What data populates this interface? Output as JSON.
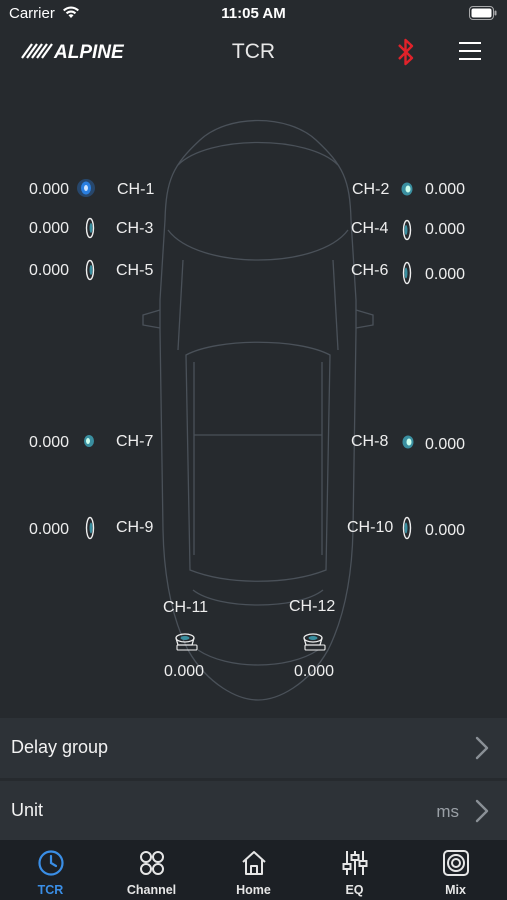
{
  "status": {
    "carrier": "Carrier",
    "time": "11:05 AM"
  },
  "header": {
    "title": "TCR",
    "logo_text": "ALPINE",
    "bt_color": "#e0222a"
  },
  "channels": [
    {
      "label": "CH-1",
      "value": "0.000"
    },
    {
      "label": "CH-2",
      "value": "0.000"
    },
    {
      "label": "CH-3",
      "value": "0.000"
    },
    {
      "label": "CH-4",
      "value": "0.000"
    },
    {
      "label": "CH-5",
      "value": "0.000"
    },
    {
      "label": "CH-6",
      "value": "0.000"
    },
    {
      "label": "CH-7",
      "value": "0.000"
    },
    {
      "label": "CH-8",
      "value": "0.000"
    },
    {
      "label": "CH-9",
      "value": "0.000"
    },
    {
      "label": "CH-10",
      "value": "0.000"
    },
    {
      "label": "CH-11",
      "value": "0.000"
    },
    {
      "label": "CH-12",
      "value": "0.000"
    }
  ],
  "settings": {
    "delay_group": {
      "label": "Delay group"
    },
    "unit": {
      "label": "Unit",
      "value": "ms"
    }
  },
  "tabs": [
    {
      "label": "TCR",
      "icon": "clock-icon",
      "active": true
    },
    {
      "label": "Channel",
      "icon": "grid-icon",
      "active": false
    },
    {
      "label": "Home",
      "icon": "home-icon",
      "active": false
    },
    {
      "label": "EQ",
      "icon": "sliders-icon",
      "active": false
    },
    {
      "label": "Mix",
      "icon": "speaker-icon",
      "active": false
    }
  ],
  "colors": {
    "accent": "#3a8ee6",
    "background": "#262a2e",
    "row": "#2d3237",
    "tabbar": "#1c2025"
  }
}
